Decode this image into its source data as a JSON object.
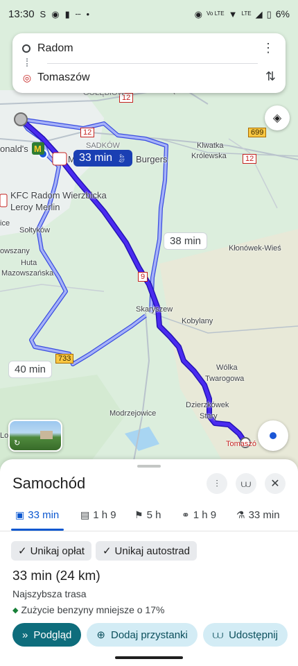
{
  "status_bar": {
    "time": "13:30",
    "battery": "6%",
    "icons": [
      "skype-icon",
      "messenger-icon",
      "sim-icon",
      "more-icon",
      "dot-icon",
      "location-icon",
      "volte-icon",
      "wifi-icon",
      "lte-icon",
      "signal-icon",
      "battery-icon"
    ]
  },
  "search": {
    "origin": "Radom",
    "destination": "Tomaszów"
  },
  "map": {
    "labels": {
      "golebiow": "GOŁĘBIÓW",
      "greczkow": "Gręczków",
      "sadkow": "SADKÓW",
      "mcdonalds": "onald's",
      "burgers": "Burgers",
      "kfc": "KFC Radom Wierzbicka",
      "leroy": "Leroy Merlin",
      "ice": "ice",
      "soltykow": "Sołtyków",
      "owszany": "owszany",
      "huta": "Huta",
      "mazowszanska": "Mazowszańska",
      "klwatka": "Klwatka",
      "krolewska": "Królewska",
      "klonowek": "Kłonówek-Wieś",
      "skaryszew": "Skaryszew",
      "kobylany": "Kobylany",
      "wolka": "Wólka",
      "twarogowa": "Twarogowa",
      "dzierzkowek": "Dzierzkówek",
      "stary": "Stary",
      "modrzejowice": "Modrzejowice",
      "tomaszow": "Tomaszó",
      "lo": "Lo",
      "road_12a": "12",
      "road_12b": "12",
      "road_9": "9",
      "road_699": "699",
      "road_12c": "12",
      "road_733": "733",
      "m_partial": "M"
    },
    "badges": {
      "main": "33 min",
      "alt1": "38 min",
      "alt2": "40 min"
    }
  },
  "sheet": {
    "title": "Samochód",
    "modes": [
      {
        "icon": "car-icon",
        "label": "33 min"
      },
      {
        "icon": "transit-icon",
        "label": "1 h 9"
      },
      {
        "icon": "walk-icon",
        "label": "5 h"
      },
      {
        "icon": "bike-icon",
        "label": "1 h 9"
      },
      {
        "icon": "ride-icon",
        "label": "33 min"
      }
    ],
    "chips": [
      "Unikaj opłat",
      "Unikaj autostrad"
    ],
    "route_time": "33 min",
    "route_distance": "(24 km)",
    "route_sub": "Najszybsza trasa",
    "route_eco": "Zużycie benzyny mniejsze o 17%",
    "actions": {
      "preview": "Podgląd",
      "add_stops": "Dodaj przystanki",
      "share": "Udostępnij"
    }
  },
  "colors": {
    "route_main": "#3b1fe0",
    "route_alt": "#8f9cf5",
    "map_bg": "#dceedd",
    "accent": "#0b57d0",
    "primary_button": "#0e6d7c"
  }
}
